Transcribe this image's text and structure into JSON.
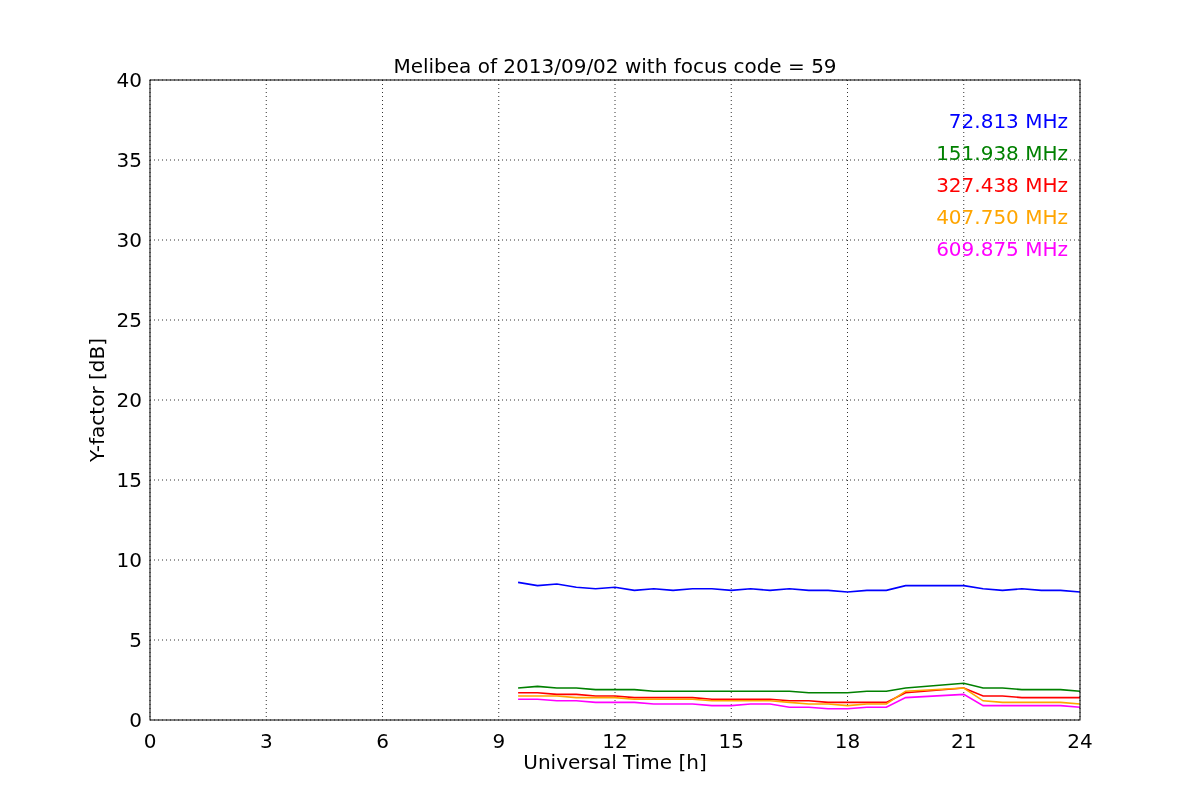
{
  "chart": {
    "chart_data": {
      "type": "line",
      "title": "Melibea of 2013/09/02 with focus code = 59",
      "xlabel": "Universal Time [h]",
      "ylabel": "Y-factor [dB]",
      "x": [
        9.5,
        10,
        10.5,
        11,
        11.5,
        12,
        12.5,
        13,
        13.5,
        14,
        14.5,
        15,
        15.5,
        16,
        16.5,
        17,
        17.5,
        18,
        18.5,
        19,
        19.5,
        21,
        21.5,
        22,
        22.5,
        23,
        23.5,
        24
      ],
      "series": [
        {
          "name": "72.813 MHz",
          "color": "#0000ff",
          "values": [
            8.6,
            8.4,
            8.5,
            8.3,
            8.2,
            8.3,
            8.1,
            8.2,
            8.1,
            8.2,
            8.2,
            8.1,
            8.2,
            8.1,
            8.2,
            8.1,
            8.1,
            8.0,
            8.1,
            8.1,
            8.4,
            8.4,
            8.2,
            8.1,
            8.2,
            8.1,
            8.1,
            8.0
          ]
        },
        {
          "name": "151.938 MHz",
          "color": "#008000",
          "values": [
            2.0,
            2.1,
            2.0,
            2.0,
            1.9,
            1.9,
            1.9,
            1.8,
            1.8,
            1.8,
            1.8,
            1.8,
            1.8,
            1.8,
            1.8,
            1.7,
            1.7,
            1.7,
            1.8,
            1.8,
            2.0,
            2.3,
            2.0,
            2.0,
            1.9,
            1.9,
            1.9,
            1.8
          ]
        },
        {
          "name": "327.438 MHz",
          "color": "#ff0000",
          "values": [
            1.7,
            1.7,
            1.6,
            1.6,
            1.5,
            1.5,
            1.4,
            1.4,
            1.4,
            1.4,
            1.3,
            1.3,
            1.3,
            1.3,
            1.2,
            1.2,
            1.1,
            1.1,
            1.1,
            1.1,
            1.7,
            2.0,
            1.5,
            1.5,
            1.4,
            1.4,
            1.4,
            1.4
          ]
        },
        {
          "name": "407.750 MHz",
          "color": "#ffa500",
          "values": [
            1.5,
            1.5,
            1.5,
            1.4,
            1.4,
            1.4,
            1.3,
            1.3,
            1.3,
            1.3,
            1.2,
            1.2,
            1.2,
            1.2,
            1.1,
            1.0,
            1.0,
            0.9,
            1.0,
            1.0,
            1.8,
            2.0,
            1.2,
            1.1,
            1.1,
            1.1,
            1.1,
            1.0
          ]
        },
        {
          "name": "609.875 MHz",
          "color": "#ff00ff",
          "values": [
            1.3,
            1.3,
            1.2,
            1.2,
            1.1,
            1.1,
            1.1,
            1.0,
            1.0,
            1.0,
            0.9,
            0.9,
            1.0,
            1.0,
            0.8,
            0.8,
            0.7,
            0.7,
            0.8,
            0.8,
            1.4,
            1.6,
            0.9,
            0.9,
            0.9,
            0.9,
            0.9,
            0.8
          ]
        }
      ],
      "xlim": [
        0,
        24
      ],
      "ylim": [
        0,
        40
      ],
      "xticks": [
        0,
        3,
        6,
        9,
        12,
        15,
        18,
        21,
        24
      ],
      "yticks": [
        0,
        5,
        10,
        15,
        20,
        25,
        30,
        35,
        40
      ],
      "grid": true
    }
  }
}
